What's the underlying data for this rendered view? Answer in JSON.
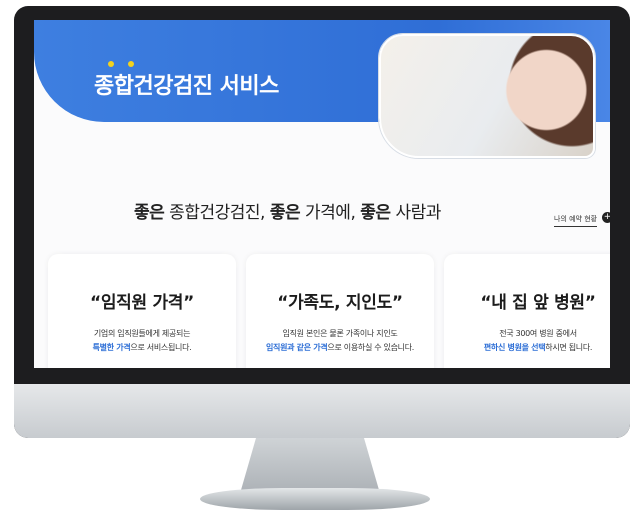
{
  "banner": {
    "title": "종합건강검진 서비스",
    "accent": "#3478de",
    "dot_color": "#f2d21f"
  },
  "tagline": {
    "w1": "좋은",
    "t1": " 종합건강검진, ",
    "w2": "좋은",
    "t2": " 가격에, ",
    "w3": "좋은",
    "t3": " 사람과"
  },
  "reservation_link": "나의 예약 현황",
  "cards": [
    {
      "title": "“임직원 가격”",
      "line1": "기업의 임직원들에게 제공되는",
      "line2_highlight": "특별한 가격",
      "line2_rest": "으로 서비스됩니다."
    },
    {
      "title": "“가족도, 지인도”",
      "line1": "임직원 본인은 물론 가족이나 지인도",
      "line2_highlight": "임직원과 같은 가격",
      "line2_rest": "으로 이용하실 수 있습니다."
    },
    {
      "title": "“내 집 앞 병원”",
      "line1": "전국 300여 병원 중에서",
      "line2_highlight": "편하신 병원을 선택",
      "line2_rest": "하시면 됩니다."
    }
  ],
  "icons": [
    "plus-icon",
    "camera-dot-icon"
  ]
}
